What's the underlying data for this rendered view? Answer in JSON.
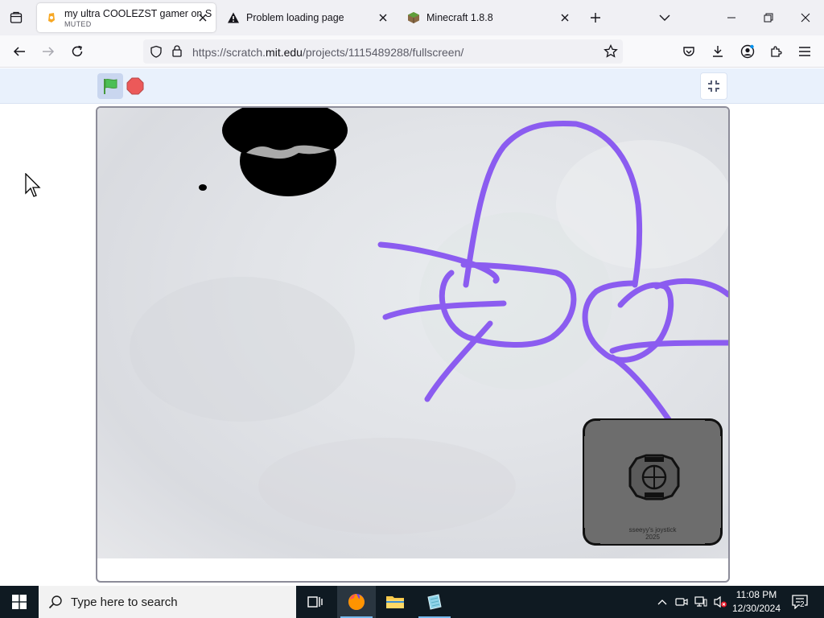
{
  "browser": {
    "tabs": [
      {
        "title": "my ultra COOLEZST gamer on S",
        "subtitle": "MUTED",
        "active": true
      },
      {
        "title": "Problem loading page",
        "active": false
      },
      {
        "title": "Minecraft 1.8.8",
        "active": false
      }
    ],
    "url_prefix": "https://scratch.",
    "url_host": "mit.edu",
    "url_path": "/projects/1115489288/fullscreen/"
  },
  "stage": {
    "joystick_label_line1": "sseeyy's joystick",
    "joystick_label_line2": "2025",
    "drawing_color": "#8b5cf0"
  },
  "taskbar": {
    "search_placeholder": "Type here to search",
    "time": "11:08 PM",
    "date": "12/30/2024",
    "notification_count": "2"
  },
  "colors": {
    "accent_blue": "#0060df",
    "scratch_green": "#4cbf56",
    "scratch_red": "#ec5959",
    "scratch_bar": "#e9f1fc"
  }
}
